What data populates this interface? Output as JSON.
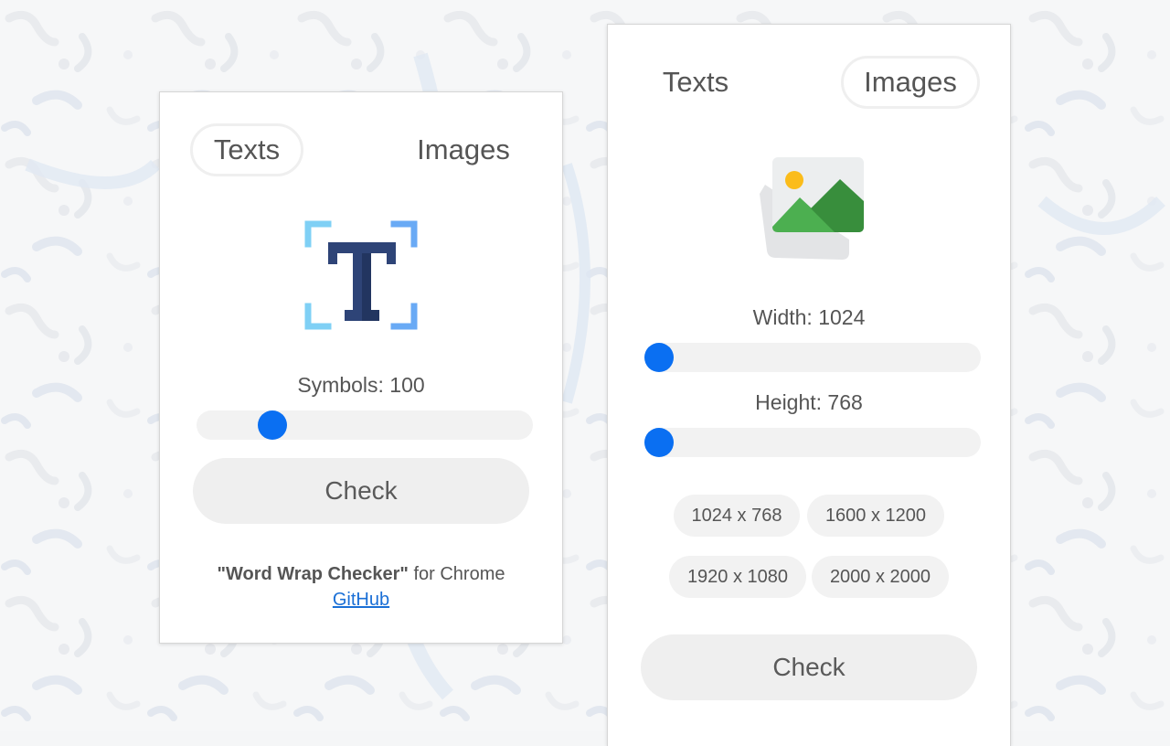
{
  "colors": {
    "accent": "#0a6ff2",
    "link": "#1a6fd6",
    "button_bg": "#efefef",
    "track_bg": "#f2f2f2"
  },
  "text_panel": {
    "tabs": [
      {
        "label": "Texts",
        "active": true
      },
      {
        "label": "Images",
        "active": false
      }
    ],
    "icon": "text-scan-icon",
    "symbols_label": "Symbols: 100",
    "symbols_slider_fraction": 0.2,
    "check_label": "Check",
    "footer": {
      "quote_name": "\"Word Wrap Checker\"",
      "suffix": " for Chrome",
      "link_label": "GitHub"
    }
  },
  "image_panel": {
    "tabs": [
      {
        "label": "Texts",
        "active": false
      },
      {
        "label": "Images",
        "active": true
      }
    ],
    "icon": "image-landscape-icon",
    "width_label": "Width: 1024",
    "width_slider_fraction": 0.0,
    "height_label": "Height: 768",
    "height_slider_fraction": 0.0,
    "presets": [
      "1024 x 768",
      "1600 x 1200",
      "1920 x 1080",
      "2000 x 2000"
    ],
    "check_label": "Check"
  }
}
